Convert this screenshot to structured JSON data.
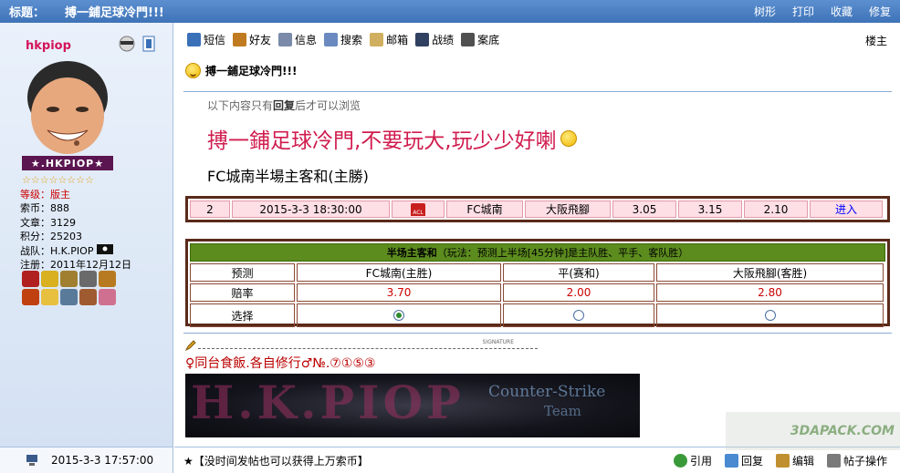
{
  "titlebar": {
    "label": "标题：",
    "title": "搏一鋪足球冷門!!!",
    "tools": [
      "树形",
      "打印",
      "收藏",
      "修复"
    ]
  },
  "user": {
    "name": "hkpiop",
    "banner": "★.HKPIOP★",
    "stars": "☆☆☆☆☆☆☆☆",
    "rank_label": "等级：",
    "rank": "版主",
    "coins_label": "索币：",
    "coins": "888",
    "posts_label": "文章：",
    "posts": "3129",
    "points_label": "积分：",
    "points": "25203",
    "team_label": "战队：",
    "team": "H.K.PIOP",
    "reg_label": "注册：",
    "reg": "2011年12月12日"
  },
  "toolbar": [
    {
      "label": "短信",
      "icon": "message-icon",
      "color": "#3a70b8"
    },
    {
      "label": "好友",
      "icon": "friends-icon",
      "color": "#c07a20"
    },
    {
      "label": "信息",
      "icon": "info-icon",
      "color": "#7a8aa8"
    },
    {
      "label": "搜索",
      "icon": "search-icon",
      "color": "#6a8ac0"
    },
    {
      "label": "邮箱",
      "icon": "mail-icon",
      "color": "#d0b060"
    },
    {
      "label": "战绩",
      "icon": "record-icon",
      "color": "#304060"
    },
    {
      "label": "案底",
      "icon": "file-icon",
      "color": "#505050"
    }
  ],
  "louzhu": "楼主",
  "post": {
    "title": "搏一鋪足球冷門!!!",
    "reply_note_pre": "以下内容只有",
    "reply_note_bold": "回复",
    "reply_note_post": "后才可以浏览",
    "headline": "搏一鋪足球冷門,不要玩大,玩少少好喇",
    "subline": "FC城南半場主客和(主勝)"
  },
  "match": {
    "num": "2",
    "datetime": "2015-3-3 18:30:00",
    "league": "ACL",
    "home": "FC城南",
    "away": "大阪飛腳",
    "o1": "3.05",
    "o2": "3.15",
    "o3": "2.10",
    "enter": "进入"
  },
  "bet": {
    "header_bold": "半场主客和",
    "header_rule": "（玩法：预测上半场[45分钟]是主队胜、平手、客队胜）",
    "row_predict": "预测",
    "opt1": "FC城南(主胜)",
    "opt2": "平(赛和)",
    "opt3": "大阪飛腳(客胜)",
    "row_odds": "赔率",
    "odds1": "3.70",
    "odds2": "2.00",
    "odds3": "2.80",
    "row_choose": "选择"
  },
  "signature": {
    "tag": "SIGNATURE",
    "line": "♀同台食飯.各自修行♂№.⑦①⑤③",
    "img_text1": "H.K.PIOP",
    "img_text2": "Counter-Strike",
    "img_text3": "Team"
  },
  "footer": {
    "date": "2015-3-3 17:57:00",
    "notice": "★【没时间发帖也可以获得上万索币】",
    "actions": [
      "引用",
      "回复",
      "编辑",
      "帖子操作"
    ]
  },
  "watermark": "3DAPACK.COM"
}
